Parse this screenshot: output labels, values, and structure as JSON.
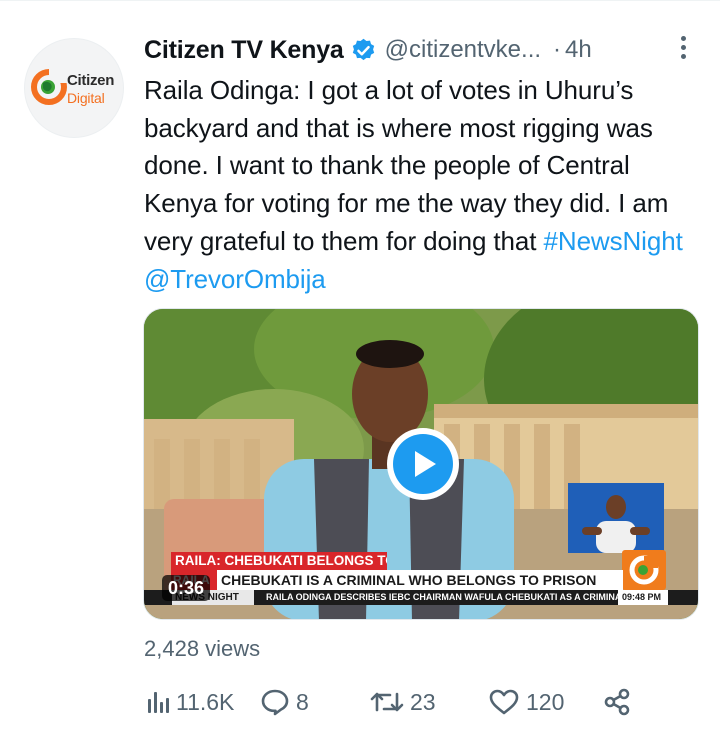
{
  "tweet": {
    "display_name": "Citizen TV Kenya",
    "handle": "@citizentvke...",
    "separator": "·",
    "time": "4h",
    "text_main": "Raila Odinga: I got a lot of votes in Uhuru’s backyard and that is where most rigging was done. I want to thank the people of Central Kenya for voting for me the way they did. I am very grateful to them for doing that",
    "hashtag": "#NewsNight",
    "mention": "@TrevorOmbija",
    "views": "2,428 views"
  },
  "avatar": {
    "logo_line1": "Citizen",
    "logo_line2": "Digital"
  },
  "media": {
    "duration": "0:36",
    "headline_red": "RAILA: CHEBUKATI BELONGS TO JAIL",
    "headline_white": "CHEBUKATI IS A CRIMINAL WHO BELONGS TO PRISON",
    "headline_tag": "RAILA",
    "show_name": "NEWS NIGHT",
    "ticker": "RAILA ODINGA DESCRIBES IEBC CHAIRMAN WAFULA CHEBUKATI AS A CRIMINAL",
    "clock": "09:48 PM"
  },
  "actions": {
    "analytics_count": "11.6K",
    "reply_count": "8",
    "retweet_count": "23",
    "like_count": "120"
  },
  "icons": {
    "verified": "verified-badge-icon",
    "more": "more-dots-icon",
    "analytics": "analytics-bars-icon",
    "reply": "reply-bubble-icon",
    "retweet": "retweet-arrows-icon",
    "like": "heart-icon",
    "share": "share-icon",
    "play": "play-icon"
  },
  "colors": {
    "link": "#1d9bf0",
    "secondary_text": "#536471",
    "primary_text": "#0f1419",
    "accent_orange": "#f37021"
  }
}
